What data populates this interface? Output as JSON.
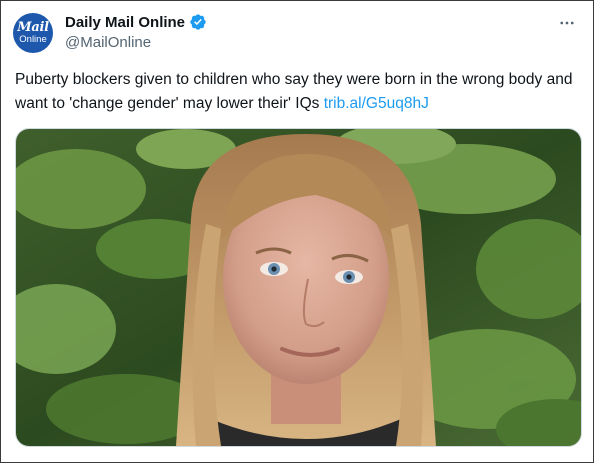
{
  "tweet": {
    "author": {
      "name": "Daily Mail Online",
      "handle": "@MailOnline",
      "avatar_text_line1": "Mail",
      "avatar_text_line2": "Online",
      "verified": true,
      "avatar_color": "#1d58ad",
      "verified_color": "#1d9bf0"
    },
    "text": "Puberty blockers given to children who say they were born in the wrong body and want to 'change gender' may lower their' IQs",
    "link": "trib.al/G5uq8hJ",
    "link_color": "#1d9bf0",
    "more_icon": "more-horizontal-icon"
  }
}
